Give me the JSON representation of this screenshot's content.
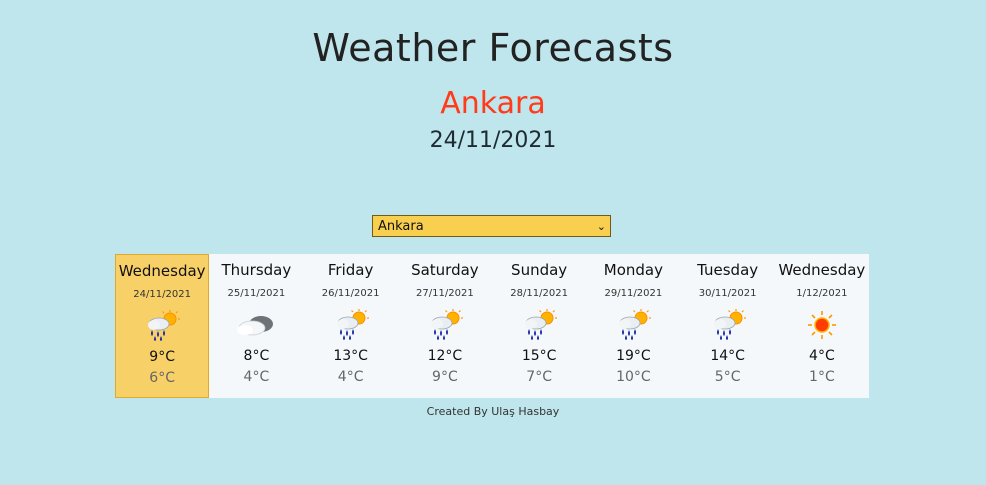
{
  "header": {
    "title": "Weather Forecasts",
    "city": "Ankara",
    "date": "24/11/2021"
  },
  "city_select": {
    "selected": "Ankara"
  },
  "forecast": [
    {
      "day": "Wednesday",
      "date": "24/11/2021",
      "icon": "rain-sun-icon",
      "max": "9°C",
      "min": "6°C",
      "active": true
    },
    {
      "day": "Thursday",
      "date": "25/11/2021",
      "icon": "cloud-icon",
      "max": "8°C",
      "min": "4°C",
      "active": false
    },
    {
      "day": "Friday",
      "date": "26/11/2021",
      "icon": "rain-sun-icon",
      "max": "13°C",
      "min": "4°C",
      "active": false
    },
    {
      "day": "Saturday",
      "date": "27/11/2021",
      "icon": "rain-sun-icon",
      "max": "12°C",
      "min": "9°C",
      "active": false
    },
    {
      "day": "Sunday",
      "date": "28/11/2021",
      "icon": "rain-sun-icon",
      "max": "15°C",
      "min": "7°C",
      "active": false
    },
    {
      "day": "Monday",
      "date": "29/11/2021",
      "icon": "rain-sun-icon",
      "max": "19°C",
      "min": "10°C",
      "active": false
    },
    {
      "day": "Tuesday",
      "date": "30/11/2021",
      "icon": "rain-sun-icon",
      "max": "14°C",
      "min": "5°C",
      "active": false
    },
    {
      "day": "Wednesday",
      "date": "1/12/2021",
      "icon": "sun-icon",
      "max": "4°C",
      "min": "1°C",
      "active": false
    }
  ],
  "footer": {
    "credit": "Created By Ulaş Hasbay"
  },
  "colors": {
    "background": "#bee6ec",
    "city": "#ff3b1a",
    "select": "#f9cf4f",
    "active_day": "#f8d068"
  }
}
